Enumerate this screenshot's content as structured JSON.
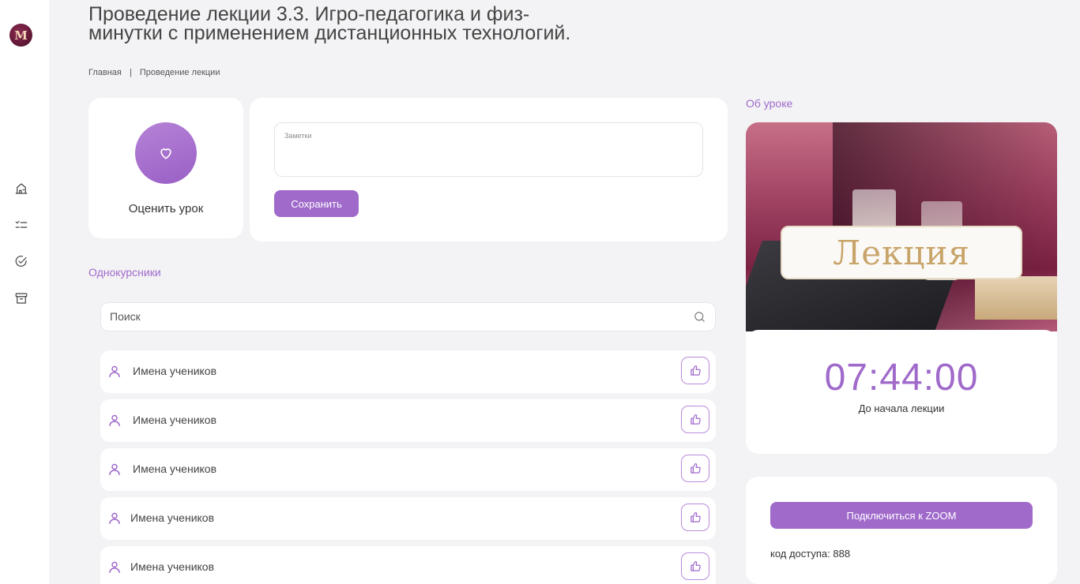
{
  "sidebar": {
    "logo_letter": "M",
    "items": [
      {
        "name": "home",
        "icon": "home-icon"
      },
      {
        "name": "tasks",
        "icon": "checklist-icon"
      },
      {
        "name": "completed",
        "icon": "check-circle-icon"
      },
      {
        "name": "archive",
        "icon": "archive-icon"
      }
    ]
  },
  "header": {
    "title_prefix": "Проведение лекции",
    "title_rest": "3.3. Игро-педагогика и физ-минутки с применением дистанционных технологий.",
    "breadcrumb": {
      "home": "Главная",
      "separator": "|",
      "current": "Проведение лекции"
    }
  },
  "rating": {
    "label": "Оценить урок"
  },
  "notes": {
    "placeholder": "Заметки",
    "save_label": "Сохранить"
  },
  "classmates": {
    "section_label": "Однокурсники",
    "search_placeholder": "Поиск",
    "students": [
      {
        "name": "Имена учеников"
      },
      {
        "name": "Имена учеников"
      },
      {
        "name": "Имена учеников"
      },
      {
        "name": "Имена учеников"
      },
      {
        "name": "Имена учеников"
      }
    ]
  },
  "about": {
    "section_label": "Об уроке",
    "banner_text": "Лекция",
    "timer": "07:44:00",
    "timer_caption": "До начала лекции"
  },
  "zoom": {
    "button_label": "Подключиться к ZOOM",
    "access_code": "код доступа: 888"
  },
  "colors": {
    "accent": "#a06acb",
    "background": "#f3f3f5",
    "card": "#ffffff"
  }
}
